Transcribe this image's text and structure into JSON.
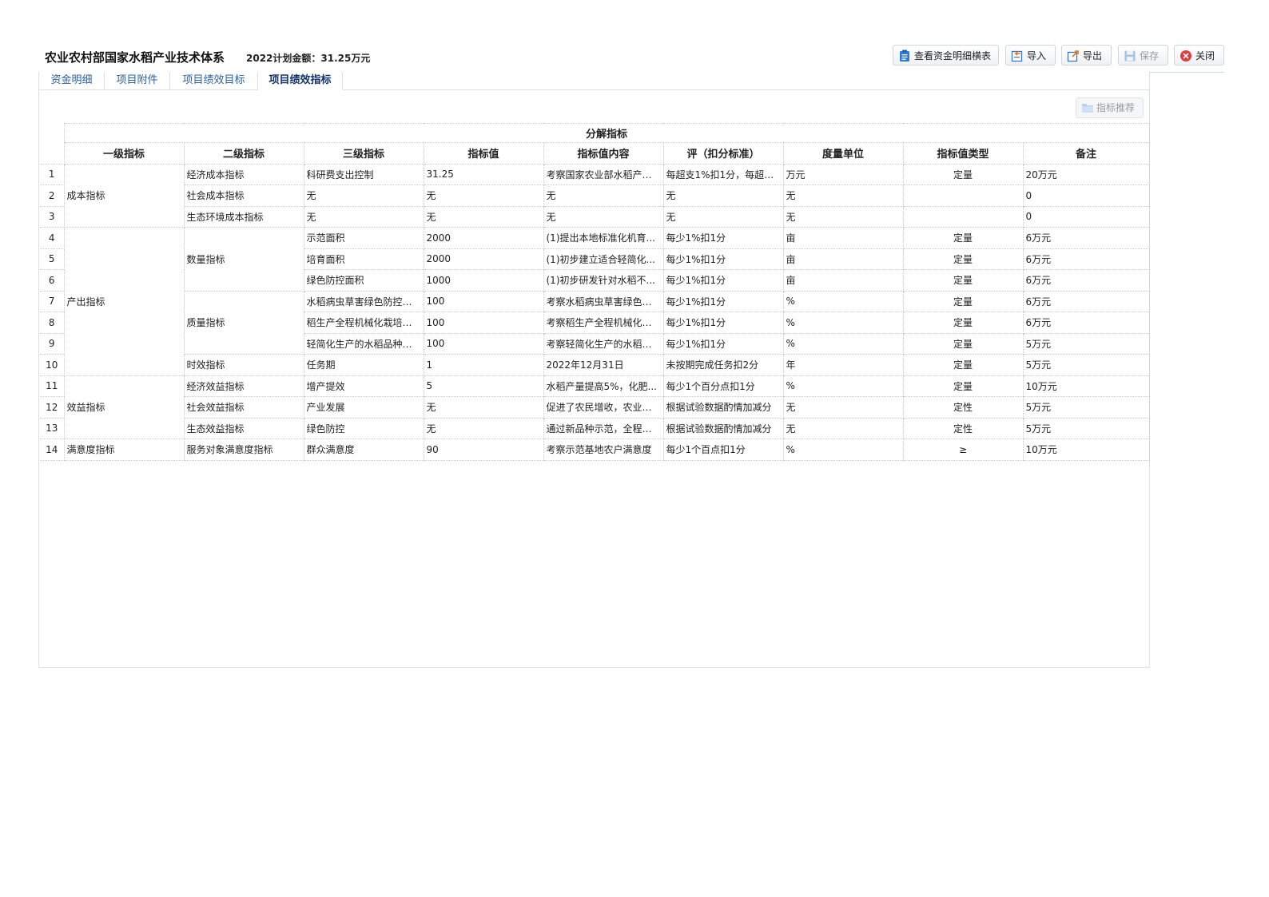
{
  "header": {
    "title": "农业农村部国家水稻产业技术体系",
    "budget": "2022计划金额：31.25万元"
  },
  "toolbar": {
    "view_funds": "查看资金明细横表",
    "import": "导入",
    "export": "导出",
    "save": "保存",
    "close": "关闭"
  },
  "tabs": [
    "资金明细",
    "项目附件",
    "项目绩效目标",
    "项目绩效指标"
  ],
  "recommend_label": "指标推荐",
  "table": {
    "group_header": "分解指标",
    "columns": [
      "一级指标",
      "二级指标",
      "三级指标",
      "指标值",
      "指标值内容",
      "评（扣分标准）",
      "度量单位",
      "指标值类型",
      "备注"
    ],
    "level1": [
      "成本指标",
      "产出指标",
      "效益指标",
      "满意度指标"
    ],
    "level2": [
      "经济成本指标",
      "社会成本指标",
      "生态环境成本指标",
      "数量指标",
      "质量指标",
      "时效指标",
      "经济效益指标",
      "社会效益指标",
      "生态效益指标",
      "服务对象满意度指标"
    ],
    "rows": [
      {
        "no": "1",
        "l3": "科研费支出控制",
        "value": "31.25",
        "content": "考察国家农业部水稻产业...",
        "score": "每超支1%扣1分，每超支...",
        "unit": "万元",
        "type": "定量",
        "note": "20万元"
      },
      {
        "no": "2",
        "l3": "无",
        "value": "无",
        "content": "无",
        "score": "无",
        "unit": "无",
        "type": "",
        "note": "0"
      },
      {
        "no": "3",
        "l3": "无",
        "value": "无",
        "content": "无",
        "score": "无",
        "unit": "无",
        "type": "",
        "note": "0"
      },
      {
        "no": "4",
        "l3": "示范面积",
        "value": "2000",
        "content": "(1)提出本地标准化机育...",
        "score": "每少1%扣1分",
        "unit": "亩",
        "type": "定量",
        "note": "6万元"
      },
      {
        "no": "5",
        "l3": "培育面积",
        "value": "2000",
        "content": "(1)初步建立适合轻简化...",
        "score": "每少1%扣1分",
        "unit": "亩",
        "type": "定量",
        "note": "6万元"
      },
      {
        "no": "6",
        "l3": "绿色防控面积",
        "value": "1000",
        "content": "(1)初步研发针对水稻不...",
        "score": "每少1%扣1分",
        "unit": "亩",
        "type": "定量",
        "note": "6万元"
      },
      {
        "no": "7",
        "l3": "水稻病虫草害绿色防控技...",
        "value": "100",
        "content": "考察水稻病虫草害绿色防...",
        "score": "每少1%扣1分",
        "unit": "%",
        "type": "定量",
        "note": "6万元"
      },
      {
        "no": "8",
        "l3": "稻生产全程机械化栽培技...",
        "value": "100",
        "content": "考察稻生产全程机械化栽...",
        "score": "每少1%扣1分",
        "unit": "%",
        "type": "定量",
        "note": "6万元"
      },
      {
        "no": "9",
        "l3": "轻简化生产的水稻品种培...",
        "value": "100",
        "content": "考察轻简化生产的水稻品...",
        "score": "每少1%扣1分",
        "unit": "%",
        "type": "定量",
        "note": "5万元"
      },
      {
        "no": "10",
        "l3": "任务期",
        "value": "1",
        "content": "2022年12月31日",
        "score": "未按期完成任务扣2分",
        "unit": "年",
        "type": "定量",
        "note": "5万元"
      },
      {
        "no": "11",
        "l3": "增产提效",
        "value": "5",
        "content": "水稻产量提高5%，化肥...",
        "score": "每少1个百分点扣1分",
        "unit": "%",
        "type": "定量",
        "note": "10万元"
      },
      {
        "no": "12",
        "l3": "产业发展",
        "value": "无",
        "content": "促进了农民增收，农业增...",
        "score": "根据试验数据酌情加减分",
        "unit": "无",
        "type": "定性",
        "note": "5万元"
      },
      {
        "no": "13",
        "l3": "绿色防控",
        "value": "无",
        "content": "通过新品种示范，全程机...",
        "score": "根据试验数据酌情加减分",
        "unit": "无",
        "type": "定性",
        "note": "5万元"
      },
      {
        "no": "14",
        "l3": "群众满意度",
        "value": "90",
        "content": "考察示范基地农户满意度",
        "score": "每少1个百点扣1分",
        "unit": "%",
        "type": "≥",
        "note": "10万元"
      }
    ]
  }
}
